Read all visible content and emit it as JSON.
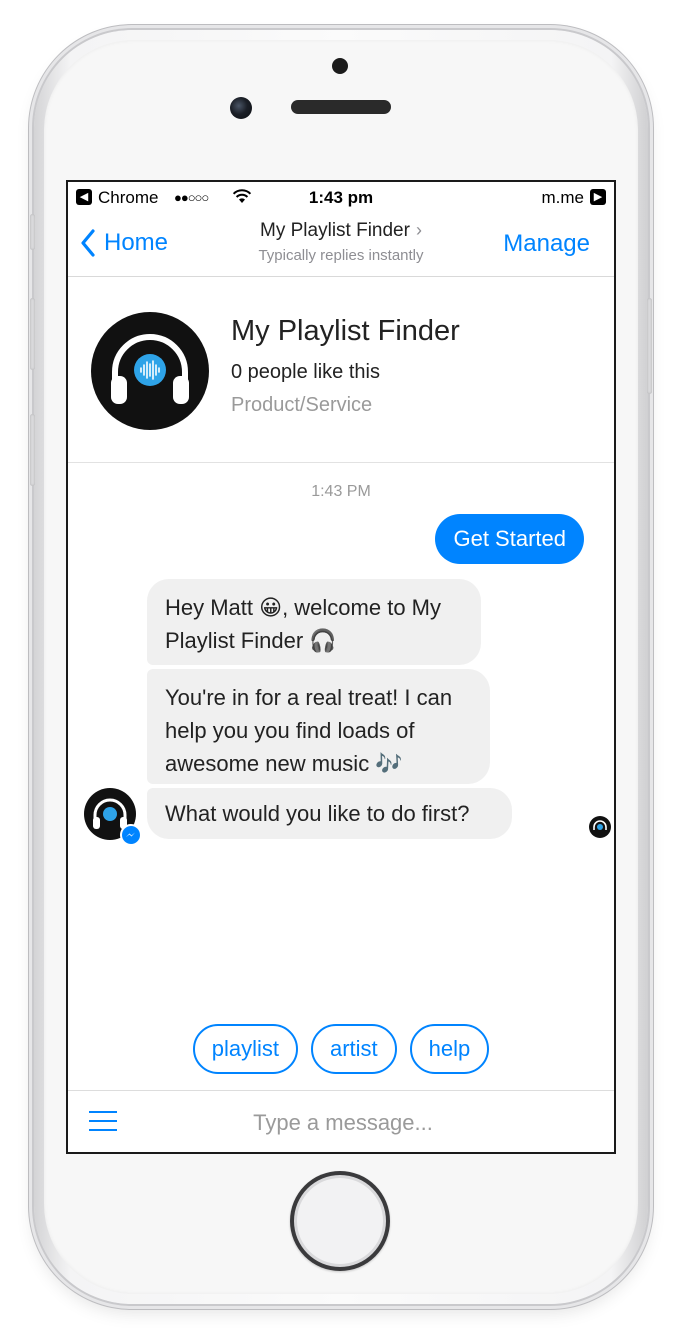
{
  "status_bar": {
    "back_app": "Chrome",
    "time": "1:43 pm",
    "domain": "m.me"
  },
  "nav": {
    "back_label": "Home",
    "title": "My Playlist Finder",
    "subtitle": "Typically replies instantly",
    "manage_label": "Manage"
  },
  "profile": {
    "name": "My Playlist Finder",
    "likes": "0 people like this",
    "category": "Product/Service"
  },
  "conversation": {
    "timestamp": "1:43 PM",
    "outgoing": "Get Started",
    "incoming": [
      "Hey Matt 😀, welcome to My Playlist Finder 🎧",
      "You're in for a real treat! I can help you you find loads of awesome new music 🎶",
      "What would you like to do first?"
    ]
  },
  "quick_replies": [
    "playlist",
    "artist",
    "help"
  ],
  "composer": {
    "placeholder": "Type a message..."
  },
  "colors": {
    "accent": "#0084ff",
    "bubble_in": "#f0f0f0",
    "avatar_bg": "#111111",
    "avatar_ring": "#2ea3e8"
  },
  "icons": {
    "nav_back": "chevron-left-icon",
    "composer_menu": "hamburger-menu-icon",
    "avatar": "headphones-icon",
    "badge": "messenger-icon"
  }
}
